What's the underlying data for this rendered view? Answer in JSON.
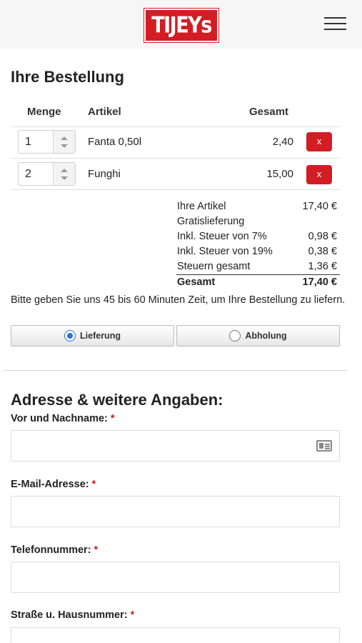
{
  "header": {
    "logo_text": "TIJEYs",
    "brand_color": "#d31d24"
  },
  "order": {
    "title": "Ihre Bestellung",
    "columns": {
      "qty": "Menge",
      "item": "Artikel",
      "total": "Gesamt"
    },
    "items": [
      {
        "qty": "1",
        "name": "Fanta 0,50l",
        "total": "2,40",
        "remove_label": "x"
      },
      {
        "qty": "2",
        "name": "Funghi",
        "total": "15,00",
        "remove_label": "x"
      }
    ],
    "summary": {
      "items_label": "Ihre Artikel",
      "items_value": "17,40 €",
      "delivery_label": "Gratislieferung",
      "tax7_label": "Inkl. Steuer von 7%",
      "tax7_value": "0,98 €",
      "tax19_label": "Inkl. Steuer von 19%",
      "tax19_value": "0,38 €",
      "tax_total_label": "Steuern gesamt",
      "tax_total_value": "1,36 €",
      "grand_label": "Gesamt",
      "grand_value": "17,40 €"
    },
    "info_text": "Bitte geben Sie uns 45 bis 60 Minuten Zeit, um Ihre Bestellung zu liefern.",
    "delivery_option": "Lieferung",
    "pickup_option": "Abholung",
    "selected_option": "Lieferung"
  },
  "address": {
    "title": "Adresse & weitere Angaben:",
    "required_mark": "*",
    "fields": {
      "name_label": "Vor und Nachname:",
      "email_label": "E-Mail-Adresse:",
      "phone_label": "Telefonnummer:",
      "street_label": "Straße u. Hausnummer:"
    }
  }
}
